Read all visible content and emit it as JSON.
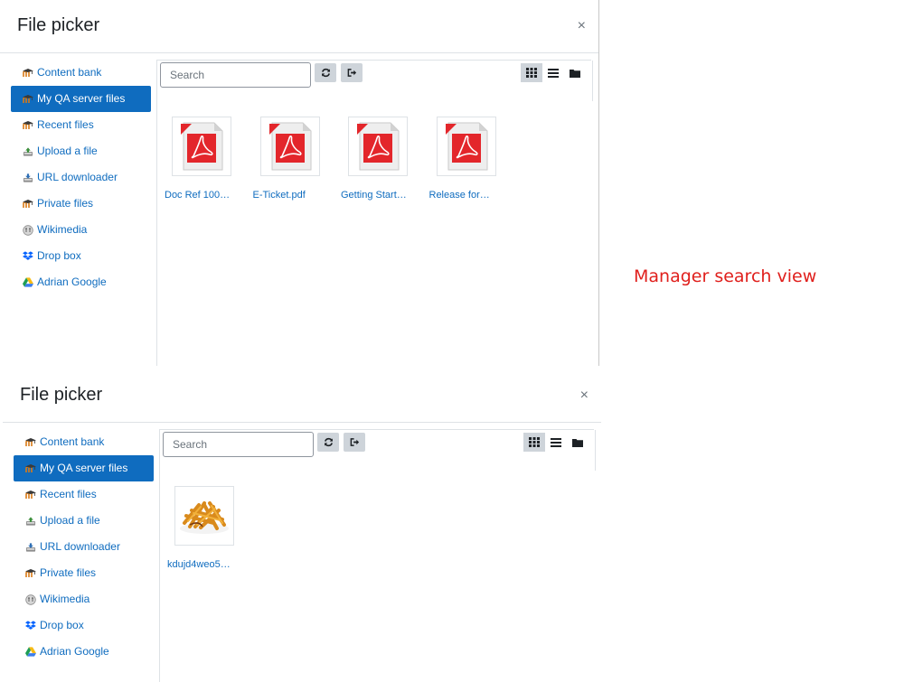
{
  "caption": "Manager search view",
  "pickers": [
    {
      "title": "File picker",
      "close_label": "×",
      "search_placeholder": "Search",
      "repositories": [
        {
          "label": "Content bank",
          "icon": "moodle-icon",
          "active": false
        },
        {
          "label": "My QA server files",
          "icon": "moodle-icon",
          "active": true
        },
        {
          "label": "Recent files",
          "icon": "moodle-icon",
          "active": false
        },
        {
          "label": "Upload a file",
          "icon": "upload-icon",
          "active": false
        },
        {
          "label": "URL downloader",
          "icon": "url-icon",
          "active": false
        },
        {
          "label": "Private files",
          "icon": "moodle-icon",
          "active": false
        },
        {
          "label": "Wikimedia",
          "icon": "wikimedia-icon",
          "active": false
        },
        {
          "label": "Drop box",
          "icon": "dropbox-icon",
          "active": false
        },
        {
          "label": "Adrian Google",
          "icon": "google-drive-icon",
          "active": false
        }
      ],
      "files": [
        {
          "name": "Doc Ref 100…",
          "type": "pdf"
        },
        {
          "name": "E-Ticket.pdf",
          "type": "pdf"
        },
        {
          "name": "Getting Start…",
          "type": "pdf"
        },
        {
          "name": "Release for…",
          "type": "pdf"
        }
      ]
    },
    {
      "title": "File picker",
      "close_label": "×",
      "search_placeholder": "Search",
      "repositories": [
        {
          "label": "Content bank",
          "icon": "moodle-icon",
          "active": false
        },
        {
          "label": "My QA server files",
          "icon": "moodle-icon",
          "active": true
        },
        {
          "label": "Recent files",
          "icon": "moodle-icon",
          "active": false
        },
        {
          "label": "Upload a file",
          "icon": "upload-icon",
          "active": false
        },
        {
          "label": "URL downloader",
          "icon": "url-icon",
          "active": false
        },
        {
          "label": "Private files",
          "icon": "moodle-icon",
          "active": false
        },
        {
          "label": "Wikimedia",
          "icon": "wikimedia-icon",
          "active": false
        },
        {
          "label": "Drop box",
          "icon": "dropbox-icon",
          "active": false
        },
        {
          "label": "Adrian Google",
          "icon": "google-drive-icon",
          "active": false
        }
      ],
      "files": [
        {
          "name": "kdujd4weo5…",
          "type": "image"
        }
      ]
    }
  ],
  "colors": {
    "accent": "#0f6cbf",
    "caption": "#e0201d",
    "pdf_red": "#e3262b"
  }
}
